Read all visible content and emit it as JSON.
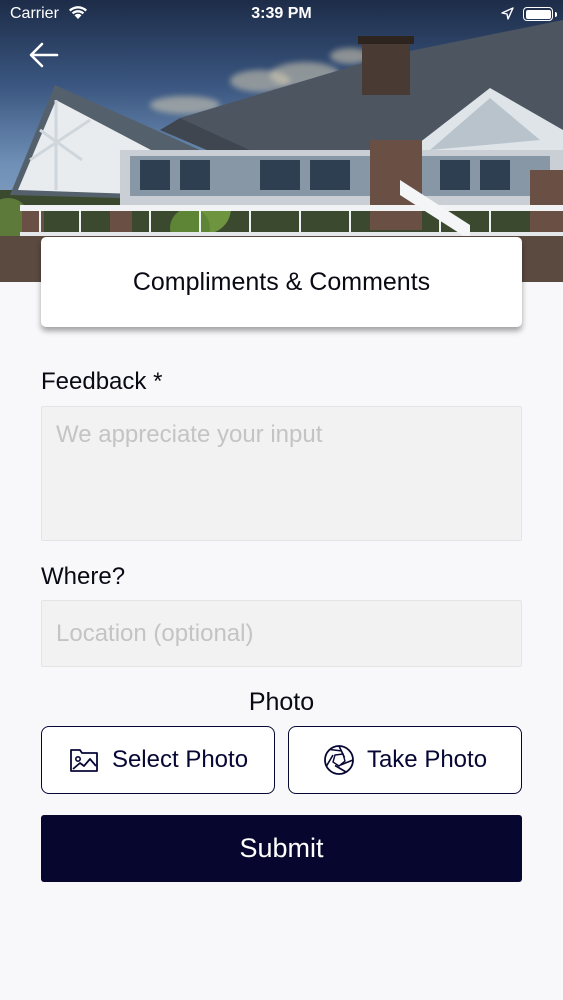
{
  "status_bar": {
    "carrier": "Carrier",
    "time": "3:39 PM",
    "icons": [
      "wifi-icon",
      "location-arrow-icon",
      "battery-icon"
    ]
  },
  "header": {
    "back_icon": "arrow-left-icon",
    "title": "Compliments & Comments"
  },
  "form": {
    "feedback": {
      "label": "Feedback *",
      "value": "",
      "placeholder": "We appreciate your input"
    },
    "where": {
      "label": "Where?",
      "value": "",
      "placeholder": "Location (optional)"
    },
    "photo": {
      "label": "Photo",
      "select_label": "Select Photo",
      "select_icon": "image-gallery-icon",
      "take_label": "Take Photo",
      "take_icon": "camera-aperture-icon"
    },
    "submit_label": "Submit"
  },
  "colors": {
    "primary": "#06062e",
    "field_bg": "#f2f2f2",
    "placeholder": "#c4c4c4",
    "page_bg": "#f8f8fa"
  }
}
